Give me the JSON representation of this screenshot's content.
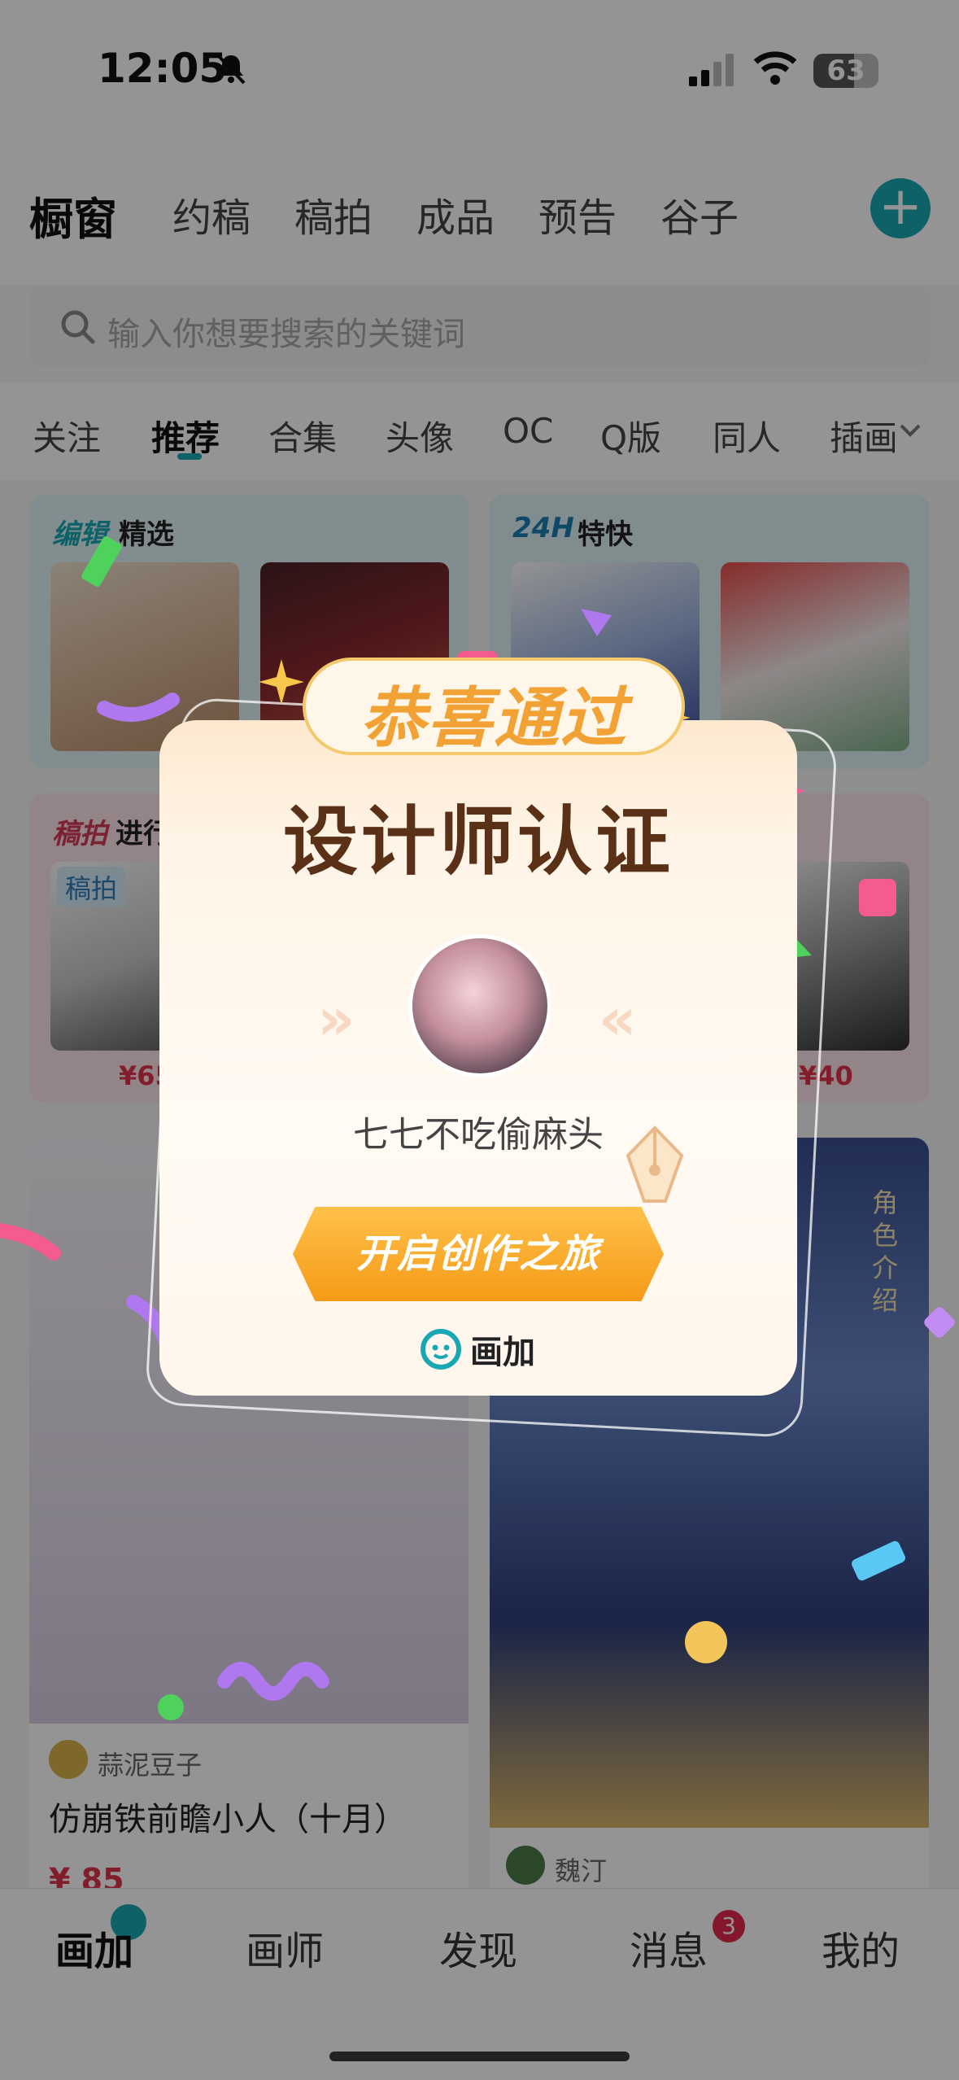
{
  "status_bar": {
    "time": "12:05",
    "battery": "63",
    "battery_level": 0.63
  },
  "top_tabs": {
    "main": "橱窗",
    "items": [
      "约稿",
      "稿拍",
      "成品",
      "预告",
      "谷子"
    ],
    "add": "+"
  },
  "search": {
    "placeholder": "输入你想要搜索的关键词"
  },
  "categories": [
    "关注",
    "推荐",
    "合集",
    "头像",
    "OC",
    "Q版",
    "同人",
    "插画"
  ],
  "panels": {
    "editor_pick": {
      "label_a": "编辑",
      "label_b": "精选"
    },
    "fast_24h": {
      "label_a": "24H",
      "label_b": "特快"
    },
    "auction": {
      "label_a": "稿拍",
      "label_b": "进行",
      "tag": "稿拍",
      "price": "¥65"
    },
    "other": {
      "price": "¥40"
    }
  },
  "feed": {
    "card1": {
      "author": "蒜泥豆子",
      "title": "仿崩铁前瞻小人（十月）",
      "price": "¥ 85"
    },
    "card2": {
      "author": "魏汀",
      "side_text": "角色介绍"
    }
  },
  "bottom_nav": {
    "items": [
      "画加",
      "画师",
      "发现",
      "消息",
      "我的"
    ],
    "badge": "3"
  },
  "modal": {
    "banner": "恭喜通过",
    "title": "设计师认证",
    "username": "七七不吃偷麻头",
    "cta": "开启创作之旅",
    "brand": "画加"
  },
  "colors": {
    "accent": "#1aa7b4",
    "cta": "#f59a17",
    "title": "#5a3016",
    "badge": "#e4284a"
  }
}
